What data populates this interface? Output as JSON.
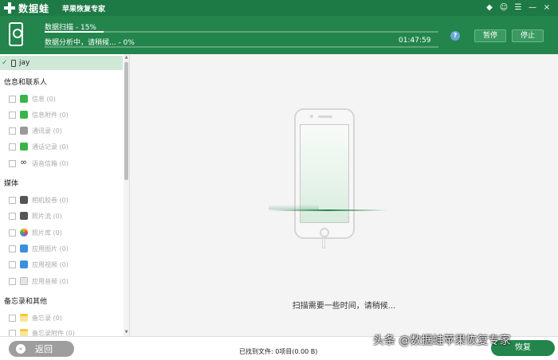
{
  "app": {
    "logo_text": "数据蛙",
    "subtitle": "苹果恢复专家"
  },
  "window_controls": [
    "◆",
    "☺",
    "☰",
    "—",
    "×"
  ],
  "progress": {
    "scan_label": "数据扫描 - 15%",
    "scan_percent": 15,
    "analysis_label": "数据分析中，请稍候... - 0%",
    "analysis_percent": 0,
    "elapsed": "01:47:59",
    "help": "?",
    "pause": "暂停",
    "stop": "停止"
  },
  "sidebar": {
    "device": "jay",
    "categories": [
      {
        "title": "信息和联系人",
        "items": [
          {
            "label": "信息 (0)",
            "icon": "message-icon"
          },
          {
            "label": "信息附件 (0)",
            "icon": "message-attachment-icon"
          },
          {
            "label": "通讯录 (0)",
            "icon": "contacts-icon"
          },
          {
            "label": "通话记录 (0)",
            "icon": "call-history-icon"
          },
          {
            "label": "语音信箱 (0)",
            "icon": "voicemail-icon"
          }
        ]
      },
      {
        "title": "媒体",
        "items": [
          {
            "label": "相机胶卷 (0)",
            "icon": "camera-roll-icon"
          },
          {
            "label": "照片流 (0)",
            "icon": "photo-stream-icon"
          },
          {
            "label": "照片库 (0)",
            "icon": "photo-library-icon"
          },
          {
            "label": "应用图片 (0)",
            "icon": "app-photos-icon"
          },
          {
            "label": "应用视频 (0)",
            "icon": "app-videos-icon"
          },
          {
            "label": "应用音频 (0)",
            "icon": "app-audio-icon"
          }
        ]
      },
      {
        "title": "备忘录和其他",
        "items": [
          {
            "label": "备忘录 (0)",
            "icon": "notes-icon"
          },
          {
            "label": "备忘录附件 (0)",
            "icon": "notes-attachment-icon"
          }
        ]
      }
    ]
  },
  "main": {
    "message": "扫描需要一些时间，请稍候..."
  },
  "footer": {
    "back": "返回",
    "found": "已找到文件: 0项目(0.00 B)",
    "recover": "恢复",
    "watermark": "头条 @数据蛙苹果恢复专家"
  },
  "colors": {
    "brand": "#1e7a45",
    "header": "#23854c",
    "selected_row": "#cfe8d8",
    "back_button": "#9e9e9e"
  }
}
